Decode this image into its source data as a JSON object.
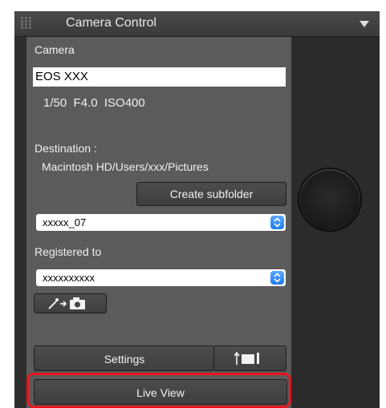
{
  "window": {
    "title": "Camera Control"
  },
  "camera": {
    "section_label": "Camera",
    "model": "EOS XXX",
    "settings_readout": "1/50  F4.0  ISO400"
  },
  "destination": {
    "label": "Destination :",
    "path": "Macintosh HD/Users/xxx/Pictures",
    "create_subfolder_label": "Create subfolder",
    "subfolder_value": "xxxxx_07"
  },
  "registered": {
    "label": "Registered to",
    "value": "xxxxxxxxxx"
  },
  "buttons": {
    "settings_label": "Settings",
    "live_view_label": "Live View"
  },
  "colors": {
    "highlight": "#e8141e",
    "select_accent": "#2f8cf6"
  },
  "icons": {
    "grip": "grip-icon",
    "menu": "menu-triangle-icon",
    "register_camera": "wand-arrow-camera-icon",
    "panel_toggle": "panel-collapse-icon"
  }
}
